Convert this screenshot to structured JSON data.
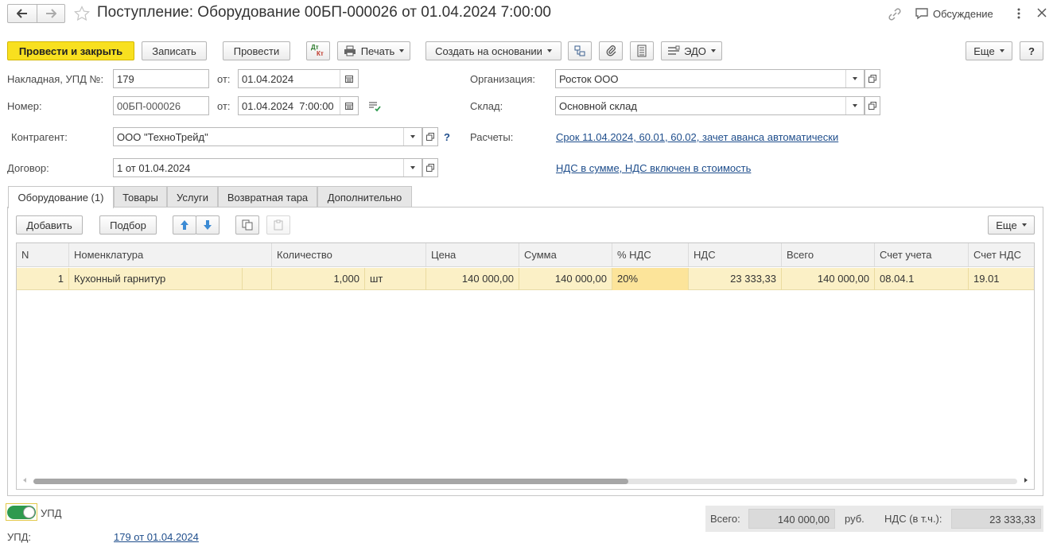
{
  "window": {
    "title": "Поступление: Оборудование 00БП-000026 от 01.04.2024 7:00:00",
    "discussion_label": "Обсуждение"
  },
  "toolbar": {
    "post_close": "Провести и закрыть",
    "save": "Записать",
    "post": "Провести",
    "dt_kt_top": "Дт",
    "dt_kt_bottom": "Кт",
    "print": "Печать",
    "create_based": "Создать на основании",
    "edo": "ЭДО",
    "more": "Еще",
    "help": "?"
  },
  "form": {
    "invoice_label": "Накладная, УПД №:",
    "invoice_number": "179",
    "from_label": "от:",
    "invoice_date": "01.04.2024",
    "number_label": "Номер:",
    "number": "00БП-000026",
    "number_date": "01.04.2024  7:00:00",
    "org_label": "Организация:",
    "org": "Росток ООО",
    "warehouse_label": "Склад:",
    "warehouse": "Основной склад",
    "counterparty_label": "Контрагент:",
    "counterparty": "ООО \"ТехноТрейд\"",
    "help_mark": "?",
    "settlements_label": "Расчеты:",
    "settlements_link": "Срок 11.04.2024, 60.01, 60.02, зачет аванса автоматически",
    "contract_label": "Договор:",
    "contract": "1 от 01.04.2024",
    "vat_link": "НДС в сумме, НДС включен в стоимость"
  },
  "tabs": [
    {
      "label": "Оборудование (1)"
    },
    {
      "label": "Товары"
    },
    {
      "label": "Услуги"
    },
    {
      "label": "Возвратная тара"
    },
    {
      "label": "Дополнительно"
    }
  ],
  "table_toolbar": {
    "add": "Добавить",
    "select": "Подбор",
    "more": "Еще"
  },
  "table": {
    "headers": [
      "N",
      "Номенклатура",
      "Количество",
      "Цена",
      "Сумма",
      "% НДС",
      "НДС",
      "Всего",
      "Счет учета",
      "Счет НДС"
    ],
    "rows": [
      {
        "n": "1",
        "name": "Кухонный гарнитур",
        "qty": "1,000",
        "unit": "шт",
        "price": "140 000,00",
        "sum": "140 000,00",
        "vat_rate": "20%",
        "vat": "23 333,33",
        "total": "140 000,00",
        "account": "08.04.1",
        "vat_account": "19.01"
      }
    ]
  },
  "footer": {
    "upd_toggle_label": "УПД",
    "upd_label": "УПД:",
    "upd_link": "179 от 01.04.2024",
    "total_label": "Всего:",
    "total": "140 000,00",
    "currency": "руб.",
    "vat_label": "НДС (в т.ч.):",
    "vat": "23 333,33"
  },
  "colors": {
    "accent": "#f8e01f",
    "row_selected": "#fbf0c6",
    "vat_cell": "#fce49a",
    "link": "#1f4e8c",
    "toggle_on": "#2e9a4e"
  }
}
